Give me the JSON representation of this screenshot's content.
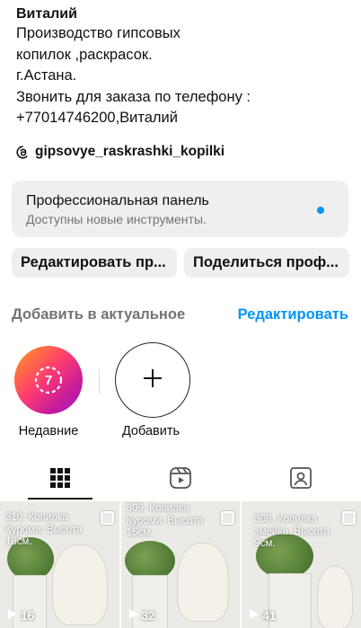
{
  "bio": {
    "name": "Виталий",
    "lines": [
      "Производство гипсовых",
      "копилок ,раскрасок.",
      "г.Астана.",
      "Звонить для заказа по телефону :",
      "+77014746200,Виталий"
    ],
    "link": "gipsovye_raskrashki_kopilki"
  },
  "pro_panel": {
    "title": "Профессиональная панель",
    "subtitle": "Доступны новые инструменты."
  },
  "buttons": {
    "edit": "Редактировать пр...",
    "share": "Поделиться проф..."
  },
  "highlights": {
    "title": "Добавить в актуальное",
    "edit": "Редактировать",
    "items": [
      {
        "label": "Недавние",
        "badge": "7"
      },
      {
        "label": "Добавить"
      }
    ]
  },
  "tabs": [
    "grid-icon",
    "reels-icon",
    "tagged-icon"
  ],
  "posts": [
    {
      "caption": "310. Копилка Куроми. Высота 18см.",
      "views": "16"
    },
    {
      "caption": "309. Копилка Куроми. Высота 15см.",
      "views": "32"
    },
    {
      "caption": "308. Копилка змейка. Высота 9см.",
      "views": "41"
    }
  ],
  "colors": {
    "accent": "#0095f6",
    "panel": "#efefef",
    "muted": "#737373"
  }
}
